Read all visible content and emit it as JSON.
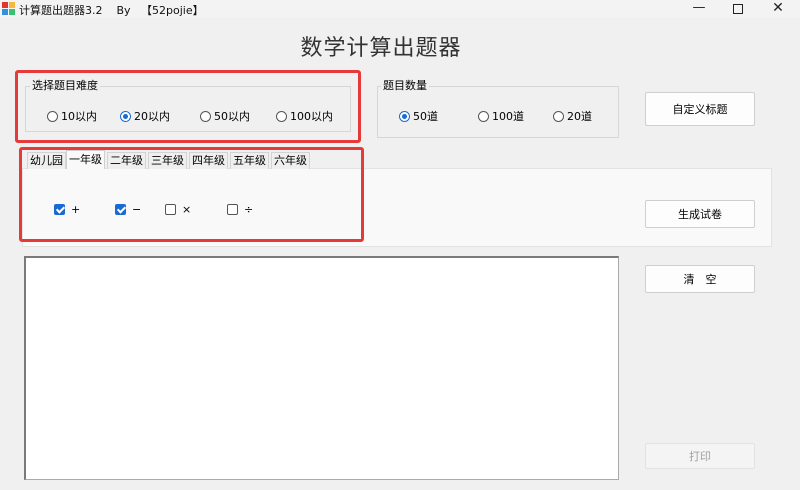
{
  "window": {
    "title": "计算题出题器3.2    By   【52pojie】",
    "minimize": "—",
    "close": "✕"
  },
  "header": {
    "title": "数学计算出题器"
  },
  "difficulty": {
    "label": "选择题目难度",
    "options": [
      {
        "label": "10以内",
        "checked": false
      },
      {
        "label": "20以内",
        "checked": true
      },
      {
        "label": "50以内",
        "checked": false
      },
      {
        "label": "100以内",
        "checked": false
      }
    ]
  },
  "quantity": {
    "label": "题目数量",
    "options": [
      {
        "label": "50道",
        "checked": true
      },
      {
        "label": "100道",
        "checked": false
      },
      {
        "label": "20道",
        "checked": false
      }
    ]
  },
  "grades": {
    "tabs": [
      "幼儿园",
      "一年级",
      "二年级",
      "三年级",
      "四年级",
      "五年级",
      "六年级"
    ],
    "active_index": 1,
    "operations": [
      {
        "label": "+",
        "checked": true
      },
      {
        "label": "−",
        "checked": true
      },
      {
        "label": "×",
        "checked": false
      },
      {
        "label": "÷",
        "checked": false
      }
    ]
  },
  "buttons": {
    "custom_title": "自定义标题",
    "generate": "生成试卷",
    "clear": "清　空",
    "print": "打印"
  },
  "output": {
    "text": ""
  },
  "colors": {
    "highlight": "#e63a3a",
    "accent": "#1a6ad3"
  }
}
